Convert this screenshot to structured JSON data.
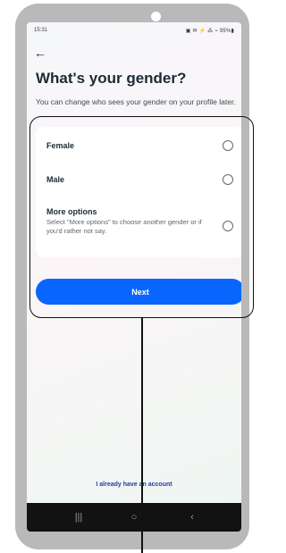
{
  "status_bar": {
    "time": "15:31",
    "icons": "▣ ✉ ⚡ ⁂ ⌁ 95%▮"
  },
  "header": {
    "back_glyph": "←",
    "title": "What's your gender?",
    "subtitle": "You can change who sees your gender on your profile later."
  },
  "options": [
    {
      "label": "Female",
      "description": "",
      "selected": false
    },
    {
      "label": "Male",
      "description": "",
      "selected": false
    },
    {
      "label": "More options",
      "description": "Select \"More options\" to choose another gender or if you'd rather not say.",
      "selected": false
    }
  ],
  "actions": {
    "next_label": "Next",
    "account_link": "I already have an account"
  },
  "nav_bar": {
    "recents_glyph": "|||",
    "home_glyph": "○",
    "back_glyph": "‹"
  },
  "colors": {
    "primary": "#0866ff",
    "text_dark": "#1c2b33",
    "annotation": "#111111"
  }
}
